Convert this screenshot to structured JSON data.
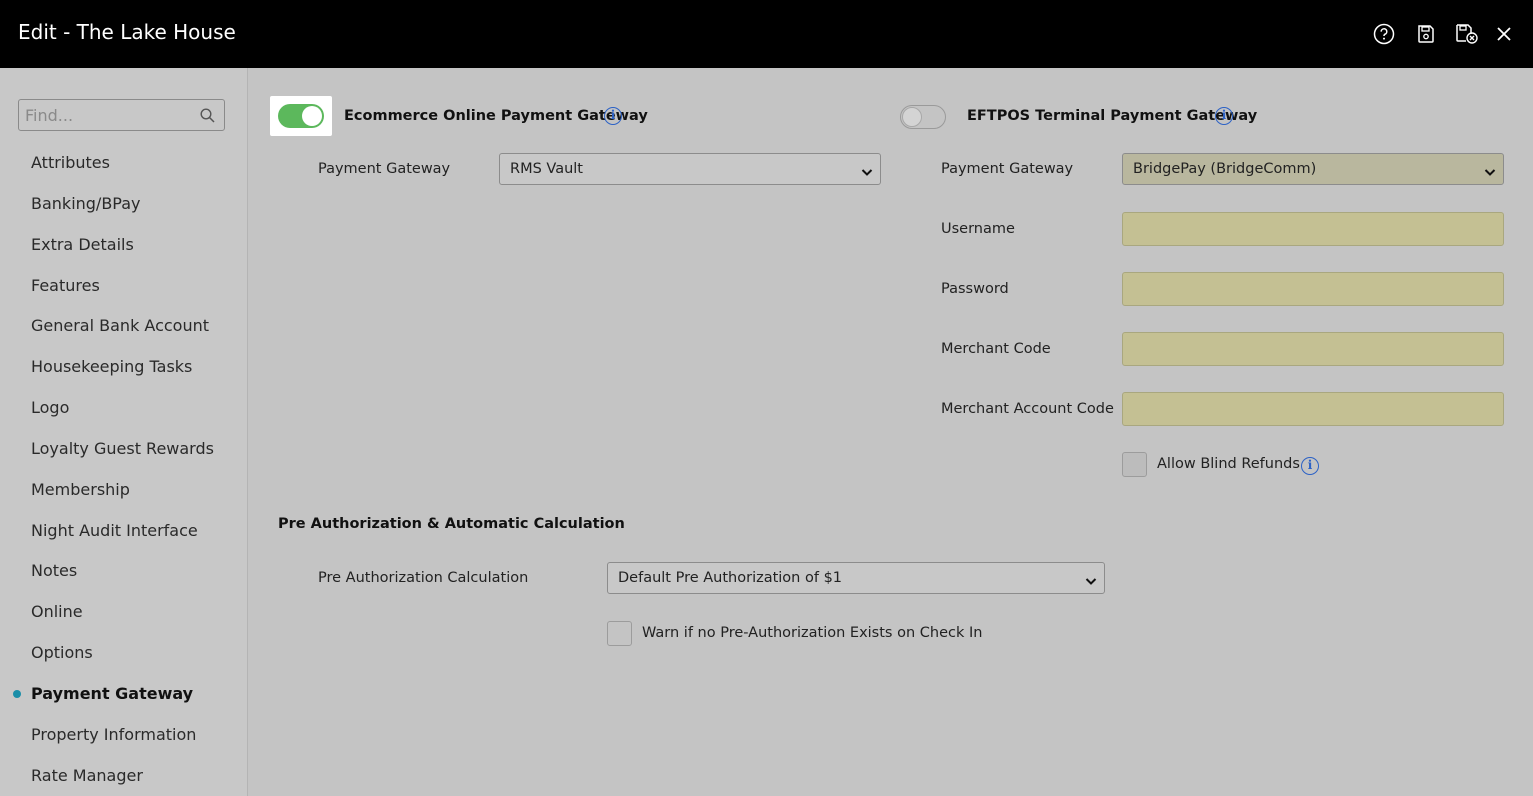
{
  "window": {
    "title": "Edit - The Lake House",
    "icons": [
      "help-icon",
      "save-icon",
      "save-close-icon",
      "close-icon"
    ]
  },
  "sidebar": {
    "search_placeholder": "Find...",
    "items": [
      {
        "label": "Attributes"
      },
      {
        "label": "Banking/BPay"
      },
      {
        "label": "Extra Details"
      },
      {
        "label": "Features"
      },
      {
        "label": "General Bank Account"
      },
      {
        "label": "Housekeeping Tasks"
      },
      {
        "label": "Logo"
      },
      {
        "label": "Loyalty Guest Rewards"
      },
      {
        "label": "Membership"
      },
      {
        "label": "Night Audit Interface"
      },
      {
        "label": "Notes"
      },
      {
        "label": "Online"
      },
      {
        "label": "Options"
      },
      {
        "label": "Payment Gateway",
        "active": true
      },
      {
        "label": "Property Information"
      },
      {
        "label": "Rate Manager"
      }
    ]
  },
  "ecommerce": {
    "toggle_label": "Ecommerce Online Payment Gateway",
    "enabled": true,
    "gateway_label": "Payment Gateway",
    "gateway_value": "RMS Vault"
  },
  "eftpos": {
    "toggle_label": "EFTPOS Terminal Payment Gateway",
    "enabled": false,
    "gateway_label": "Payment Gateway",
    "gateway_value": "BridgePay (BridgeComm)",
    "username_label": "Username",
    "username_value": "",
    "password_label": "Password",
    "password_value": "",
    "merchant_code_label": "Merchant Code",
    "merchant_code_value": "",
    "merchant_account_code_label": "Merchant Account Code",
    "merchant_account_code_value": "",
    "allow_blind_refunds_label": "Allow Blind Refunds",
    "allow_blind_refunds_checked": false
  },
  "preauth": {
    "heading": "Pre Authorization & Automatic Calculation",
    "calc_label": "Pre Authorization Calculation",
    "calc_value": "Default Pre Authorization of $1",
    "warn_label": "Warn if no Pre-Authorization Exists on Check In",
    "warn_checked": false
  },
  "colors": {
    "accent": "#1a8ea8",
    "toggle_on": "#5cb85c",
    "info": "#2c62c6",
    "required_field": "#c4c093"
  }
}
